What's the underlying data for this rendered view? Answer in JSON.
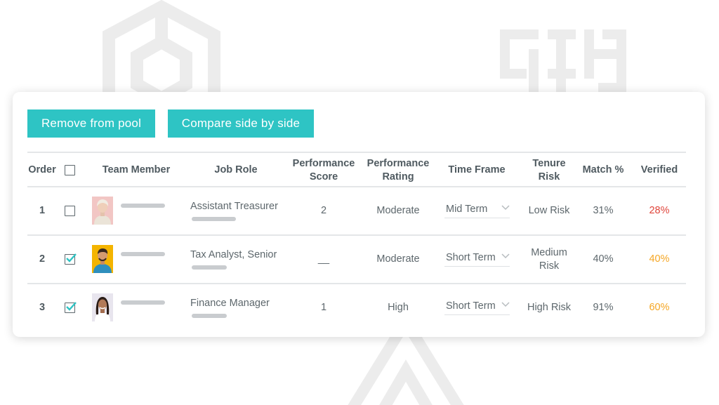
{
  "toolbar": {
    "remove_label": "Remove from pool",
    "compare_label": "Compare side by side"
  },
  "columns": {
    "order": "Order",
    "team_member": "Team Member",
    "job_role": "Job Role",
    "performance_score": "Performance Score",
    "performance_rating": "Performance Rating",
    "time_frame": "Time Frame",
    "tenure_risk": "Tenure Risk",
    "match": "Match %",
    "verified": "Verified"
  },
  "rows": [
    {
      "order": "1",
      "checked": false,
      "job_role": "Assistant Treasurer",
      "performance_score": "2",
      "performance_rating": "Moderate",
      "time_frame": "Mid Term",
      "tenure_risk": "Low Risk",
      "match": "31%",
      "verified": "28%",
      "verified_color": "#e0453b"
    },
    {
      "order": "2",
      "checked": true,
      "job_role": "Tax Analyst, Senior",
      "performance_score": "__",
      "performance_rating": "Moderate",
      "time_frame": "Short Term",
      "tenure_risk": "Medium Risk",
      "match": "40%",
      "verified": "40%",
      "verified_color": "#f5a623"
    },
    {
      "order": "3",
      "checked": true,
      "job_role": "Finance Manager",
      "performance_score": "1",
      "performance_rating": "High",
      "time_frame": "Short Term",
      "tenure_risk": "High Risk",
      "match": "91%",
      "verified": "60%",
      "verified_color": "#f5a623"
    }
  ],
  "colors": {
    "accent": "#2ec4c4",
    "verified_low": "#e0453b",
    "verified_mid": "#f5a623",
    "check": "#2ec4c4"
  },
  "icons": {
    "checkbox": "checkbox-icon",
    "checkmark": "checkmark-icon",
    "dropdown": "chevron-down-icon"
  }
}
